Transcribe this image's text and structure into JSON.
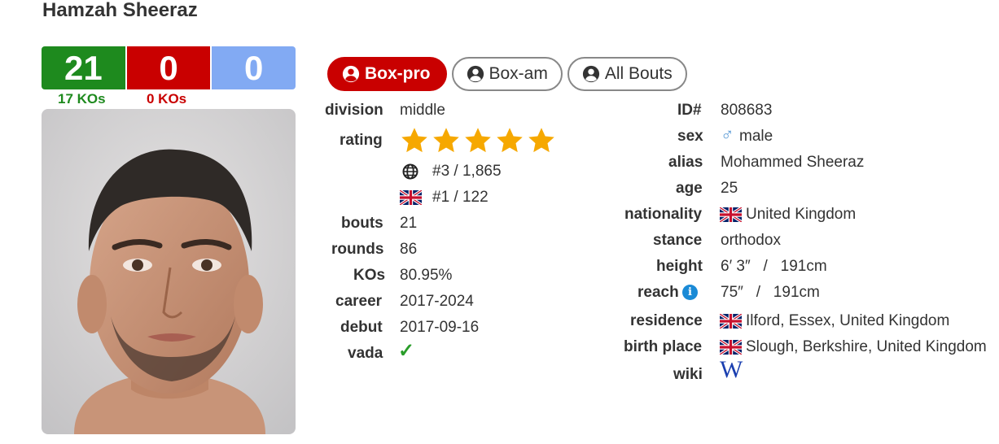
{
  "boxer": {
    "name": "Hamzah Sheeraz",
    "record": {
      "wins": "21",
      "losses": "0",
      "draws": "0"
    },
    "kos": {
      "wins": "17 KOs",
      "losses": "0 KOs"
    }
  },
  "tabs": [
    {
      "label": "Box-pro",
      "active": true
    },
    {
      "label": "Box-am",
      "active": false
    },
    {
      "label": "All Bouts",
      "active": false
    }
  ],
  "left_table": {
    "division": {
      "label": "division",
      "value": "middle"
    },
    "rating": {
      "label": "rating",
      "stars": 5,
      "world_rank": "#3 / 1,865",
      "country_rank": "#1 / 122"
    },
    "bouts": {
      "label": "bouts",
      "value": "21"
    },
    "rounds": {
      "label": "rounds",
      "value": "86"
    },
    "kos": {
      "label": "KOs",
      "value": "80.95%"
    },
    "career": {
      "label": "career",
      "value": "2017-2024"
    },
    "debut": {
      "label": "debut",
      "value": "2017-09-16"
    },
    "vada": {
      "label": "vada",
      "value": "✓"
    }
  },
  "right_table": {
    "id": {
      "label": "ID#",
      "value": "808683"
    },
    "sex": {
      "label": "sex",
      "value": "male"
    },
    "alias": {
      "label": "alias",
      "value": "Mohammed Sheeraz"
    },
    "age": {
      "label": "age",
      "value": "25"
    },
    "nationality": {
      "label": "nationality",
      "value": "United Kingdom"
    },
    "stance": {
      "label": "stance",
      "value": "orthodox"
    },
    "height": {
      "label": "height",
      "value": "6′ 3″   /   191cm"
    },
    "reach": {
      "label": "reach",
      "value": "75″   /   191cm"
    },
    "residence": {
      "label": "residence",
      "value": "Ilford, Essex, United Kingdom"
    },
    "birth_place": {
      "label": "birth place",
      "value": "Slough, Berkshire, United Kingdom"
    },
    "wiki": {
      "label": "wiki",
      "value": "W"
    }
  },
  "colors": {
    "win": "#1e8a1e",
    "loss": "#c90000",
    "draw": "#82aaf3",
    "star": "#f6a800",
    "info": "#1a8ad6",
    "male_symbol": "#5b9bd5",
    "check": "#2a9d2a",
    "wiki": "#1a3fb0"
  },
  "icons": [
    "user-circle-icon",
    "globe-icon",
    "uk-flag-icon",
    "male-symbol-icon",
    "info-icon",
    "check-icon",
    "wikipedia-icon",
    "star-icon"
  ]
}
